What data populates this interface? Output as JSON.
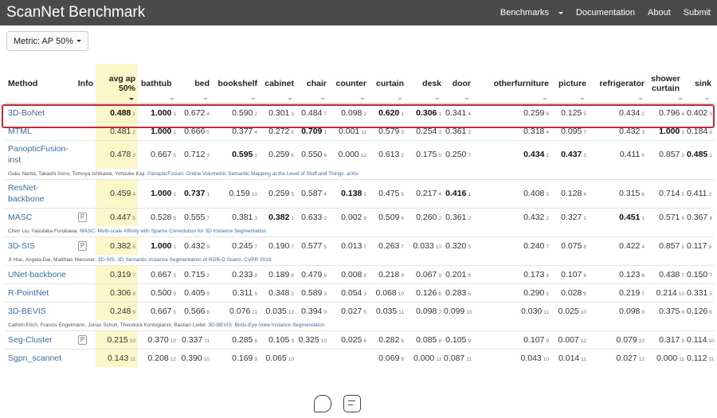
{
  "app_title": "ScanNet Benchmark",
  "nav": {
    "benchmarks": "Benchmarks",
    "documentation": "Documentation",
    "about": "About",
    "submit": "Submit"
  },
  "metric_label": "Metric: AP 50%",
  "columns": {
    "method": "Method",
    "info": "Info",
    "avg": "avg ap 50%",
    "bathtub": "bathtub",
    "bed": "bed",
    "bookshelf": "bookshelf",
    "cabinet": "cabinet",
    "chair": "chair",
    "counter": "counter",
    "curtain": "curtain",
    "desk": "desk",
    "door": "door",
    "otherfurniture": "otherfurniture",
    "picture": "picture",
    "refrigerator": "refrigerator",
    "shower_curtain": "shower curtain",
    "sink": "sink"
  },
  "rows": [
    {
      "name": "3D-BoNet",
      "info": "",
      "highlighted": true,
      "cells": [
        [
          "0.488",
          "1",
          true
        ],
        [
          "1.000",
          "1",
          true
        ],
        [
          "0.672",
          "4",
          false
        ],
        [
          "0.590",
          "2",
          false
        ],
        [
          "0.301",
          "3",
          false
        ],
        [
          "0.484",
          "7",
          false
        ],
        [
          "0.098",
          "2",
          false
        ],
        [
          "0.620",
          "1",
          true
        ],
        [
          "0.306",
          "1",
          true
        ],
        [
          "0.341",
          "4",
          false
        ],
        [
          "0.259",
          "6",
          false
        ],
        [
          "0.125",
          "5",
          false
        ],
        [
          "0.434",
          "2",
          false
        ],
        [
          "0.796",
          "4",
          false
        ],
        [
          "0.402",
          "3",
          false
        ]
      ],
      "cite": "",
      "cite_link": ""
    },
    {
      "name": "MTML",
      "info": "",
      "cells": [
        [
          "0.481",
          "2",
          false
        ],
        [
          "1.000",
          "1",
          true
        ],
        [
          "0.666",
          "5",
          false
        ],
        [
          "0.377",
          "4",
          false
        ],
        [
          "0.272",
          "4",
          false
        ],
        [
          "0.709",
          "1",
          true
        ],
        [
          "0.001",
          "11",
          false
        ],
        [
          "0.579",
          "3",
          false
        ],
        [
          "0.254",
          "3",
          false
        ],
        [
          "0.361",
          "3",
          false
        ],
        [
          "0.318",
          "4",
          false
        ],
        [
          "0.095",
          "7",
          false
        ],
        [
          "0.432",
          "3",
          false
        ],
        [
          "1.000",
          "1",
          true
        ],
        [
          "0.184",
          "6",
          false
        ]
      ],
      "cite": "",
      "cite_link": ""
    },
    {
      "name": "PanopticFusion-inst",
      "info": "",
      "cells": [
        [
          "0.478",
          "3",
          false
        ],
        [
          "0.667",
          "5",
          false
        ],
        [
          "0.712",
          "3",
          false
        ],
        [
          "0.595",
          "1",
          true
        ],
        [
          "0.259",
          "6",
          false
        ],
        [
          "0.550",
          "6",
          false
        ],
        [
          "0.000",
          "12",
          false
        ],
        [
          "0.613",
          "2",
          false
        ],
        [
          "0.175",
          "5",
          false
        ],
        [
          "0.250",
          "7",
          false
        ],
        [
          "0.434",
          "1",
          true
        ],
        [
          "0.437",
          "1",
          true
        ],
        [
          "0.411",
          "5",
          false
        ],
        [
          "0.857",
          "2",
          false
        ],
        [
          "0.485",
          "1",
          true
        ]
      ],
      "cite": "Gaku Narita, Takashi Seno, Tomoya Ishikawa, Yohsuke Kaji: ",
      "cite_link": "PanopticFusion: Online Volumetric Semantic Mapping at the Level of Stuff and Things. arXiv"
    },
    {
      "name": "ResNet-backbone",
      "info": "",
      "cells": [
        [
          "0.459",
          "4",
          false
        ],
        [
          "1.000",
          "1",
          true
        ],
        [
          "0.737",
          "1",
          true
        ],
        [
          "0.159",
          "10",
          false
        ],
        [
          "0.259",
          "5",
          false
        ],
        [
          "0.587",
          "4",
          false
        ],
        [
          "0.138",
          "1",
          true
        ],
        [
          "0.475",
          "5",
          false
        ],
        [
          "0.217",
          "4",
          false
        ],
        [
          "0.416",
          "1",
          true
        ],
        [
          "0.408",
          "3",
          false
        ],
        [
          "0.128",
          "4",
          false
        ],
        [
          "0.315",
          "6",
          false
        ],
        [
          "0.714",
          "5",
          false
        ],
        [
          "0.411",
          "2",
          false
        ]
      ],
      "cite": "",
      "cite_link": ""
    },
    {
      "name": "MASC",
      "info": "P",
      "cells": [
        [
          "0.447",
          "5",
          false
        ],
        [
          "0.528",
          "8",
          false
        ],
        [
          "0.555",
          "7",
          false
        ],
        [
          "0.381",
          "3",
          false
        ],
        [
          "0.382",
          "1",
          true
        ],
        [
          "0.633",
          "2",
          false
        ],
        [
          "0.002",
          "9",
          false
        ],
        [
          "0.509",
          "4",
          false
        ],
        [
          "0.260",
          "2",
          false
        ],
        [
          "0.361",
          "2",
          false
        ],
        [
          "0.432",
          "2",
          false
        ],
        [
          "0.327",
          "2",
          false
        ],
        [
          "0.451",
          "1",
          true
        ],
        [
          "0.571",
          "6",
          false
        ],
        [
          "0.367",
          "4",
          false
        ]
      ],
      "cite": "Chen Liu, Yasutaka Furukawa: ",
      "cite_link": "MASC: Multi-scale Affinity with Sparse Convolution for 3D Instance Segmentation"
    },
    {
      "name": "3D-SIS",
      "info": "P",
      "cells": [
        [
          "0.382",
          "6",
          false
        ],
        [
          "1.000",
          "1",
          true
        ],
        [
          "0.432",
          "9",
          false
        ],
        [
          "0.245",
          "7",
          false
        ],
        [
          "0.190",
          "7",
          false
        ],
        [
          "0.577",
          "5",
          false
        ],
        [
          "0.013",
          "7",
          false
        ],
        [
          "0.263",
          "7",
          false
        ],
        [
          "0.033",
          "10",
          false
        ],
        [
          "0.320",
          "5",
          false
        ],
        [
          "0.240",
          "7",
          false
        ],
        [
          "0.075",
          "8",
          false
        ],
        [
          "0.422",
          "4",
          false
        ],
        [
          "0.857",
          "2",
          false
        ],
        [
          "0.117",
          "9",
          false
        ]
      ],
      "cite": "Ji Hou, Angela Dai, Matthias Niessner: ",
      "cite_link": "3D-SIS: 3D Semantic Instance Segmentation of RGB-D Scans. CVPR 2019"
    },
    {
      "name": "UNet-backbone",
      "info": "",
      "cells": [
        [
          "0.319",
          "7",
          false
        ],
        [
          "0.667",
          "5",
          false
        ],
        [
          "0.715",
          "2",
          false
        ],
        [
          "0.233",
          "8",
          false
        ],
        [
          "0.189",
          "8",
          false
        ],
        [
          "0.479",
          "8",
          false
        ],
        [
          "0.008",
          "8",
          false
        ],
        [
          "0.218",
          "9",
          false
        ],
        [
          "0.067",
          "9",
          false
        ],
        [
          "0.201",
          "8",
          false
        ],
        [
          "0.173",
          "8",
          false
        ],
        [
          "0.107",
          "6",
          false
        ],
        [
          "0.123",
          "8",
          false
        ],
        [
          "0.438",
          "7",
          false
        ],
        [
          "0.150",
          "7",
          false
        ]
      ],
      "cite": "",
      "cite_link": ""
    },
    {
      "name": "R-PointNet",
      "info": "",
      "cells": [
        [
          "0.306",
          "8",
          false
        ],
        [
          "0.500",
          "9",
          false
        ],
        [
          "0.405",
          "9",
          false
        ],
        [
          "0.311",
          "5",
          false
        ],
        [
          "0.348",
          "2",
          false
        ],
        [
          "0.589",
          "3",
          false
        ],
        [
          "0.054",
          "3",
          false
        ],
        [
          "0.068",
          "10",
          false
        ],
        [
          "0.126",
          "6",
          false
        ],
        [
          "0.283",
          "6",
          false
        ],
        [
          "0.290",
          "5",
          false
        ],
        [
          "0.028",
          "9",
          false
        ],
        [
          "0.219",
          "7",
          false
        ],
        [
          "0.214",
          "10",
          false
        ],
        [
          "0.331",
          "5",
          false
        ]
      ],
      "cite": "",
      "cite_link": ""
    },
    {
      "name": "3D-BEVIS",
      "info": "",
      "cells": [
        [
          "0.248",
          "9",
          false
        ],
        [
          "0.667",
          "5",
          false
        ],
        [
          "0.566",
          "6",
          false
        ],
        [
          "0.076",
          "11",
          false
        ],
        [
          "0.035",
          "12",
          false
        ],
        [
          "0.394",
          "9",
          false
        ],
        [
          "0.027",
          "5",
          false
        ],
        [
          "0.035",
          "11",
          false
        ],
        [
          "0.098",
          "7",
          false
        ],
        [
          "0.099",
          "10",
          false
        ],
        [
          "0.030",
          "11",
          false
        ],
        [
          "0.025",
          "10",
          false
        ],
        [
          "0.098",
          "9",
          false
        ],
        [
          "0.375",
          "8",
          false
        ],
        [
          "0.126",
          "8",
          false
        ]
      ],
      "cite": "Cathrin Elich, Francis Engelmann, Jonas Schult, Theodora Kontogianni, Bastian Leibe: ",
      "cite_link": "3D-BEVIS: Birds-Eye-View Instance Segmentation"
    },
    {
      "name": "Seg-Cluster",
      "info": "P",
      "cells": [
        [
          "0.215",
          "10",
          false
        ],
        [
          "0.370",
          "10",
          false
        ],
        [
          "0.337",
          "11",
          false
        ],
        [
          "0.285",
          "6",
          false
        ],
        [
          "0.105",
          "9",
          false
        ],
        [
          "0.325",
          "10",
          false
        ],
        [
          "0.025",
          "6",
          false
        ],
        [
          "0.282",
          "6",
          false
        ],
        [
          "0.085",
          "8",
          false
        ],
        [
          "0.105",
          "9",
          false
        ],
        [
          "0.107",
          "9",
          false
        ],
        [
          "0.007",
          "12",
          false
        ],
        [
          "0.079",
          "10",
          false
        ],
        [
          "0.317",
          "9",
          false
        ],
        [
          "0.114",
          "10",
          false
        ]
      ],
      "cite": "",
      "cite_link": ""
    },
    {
      "name": "Sgpn_scannet",
      "info": "",
      "cells": [
        [
          "0.143",
          "11",
          false
        ],
        [
          "0.208",
          "12",
          false
        ],
        [
          "0.390",
          "10",
          false
        ],
        [
          "0.169",
          "9",
          false
        ],
        [
          "0.065",
          "10",
          false
        ],
        [
          "",
          "",
          false
        ],
        [
          "",
          "",
          false
        ],
        [
          "0.069",
          "9",
          false
        ],
        [
          "0.000",
          "11",
          false
        ],
        [
          "0.087",
          "11",
          false
        ],
        [
          "0.043",
          "10",
          false
        ],
        [
          "0.014",
          "11",
          false
        ],
        [
          "0.027",
          "12",
          false
        ],
        [
          "0.000",
          "11",
          false
        ],
        [
          "0.112",
          "11",
          false
        ]
      ],
      "cite": "",
      "cite_link": ""
    }
  ]
}
